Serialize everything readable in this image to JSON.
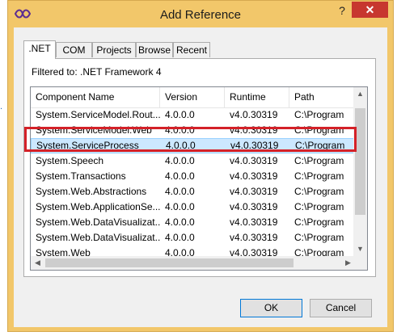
{
  "window": {
    "title": "Add Reference",
    "help_label": "?",
    "close_label": "✕"
  },
  "tabs": [
    {
      "label": ".NET",
      "active": true
    },
    {
      "label": "COM"
    },
    {
      "label": "Projects"
    },
    {
      "label": "Browse"
    },
    {
      "label": "Recent"
    }
  ],
  "filter_text": "Filtered to: .NET Framework 4",
  "columns": [
    "Component Name",
    "Version",
    "Runtime",
    "Path"
  ],
  "rows": [
    [
      "System.ServiceModel.Rout...",
      "4.0.0.0",
      "v4.0.30319",
      "C:\\Program"
    ],
    [
      "System.ServiceModel.Web",
      "4.0.0.0",
      "v4.0.30319",
      "C:\\Program"
    ],
    [
      "System.ServiceProcess",
      "4.0.0.0",
      "v4.0.30319",
      "C:\\Program"
    ],
    [
      "System.Speech",
      "4.0.0.0",
      "v4.0.30319",
      "C:\\Program"
    ],
    [
      "System.Transactions",
      "4.0.0.0",
      "v4.0.30319",
      "C:\\Program"
    ],
    [
      "System.Web.Abstractions",
      "4.0.0.0",
      "v4.0.30319",
      "C:\\Program"
    ],
    [
      "System.Web.ApplicationSe...",
      "4.0.0.0",
      "v4.0.30319",
      "C:\\Program"
    ],
    [
      "System.Web.DataVisualizat...",
      "4.0.0.0",
      "v4.0.30319",
      "C:\\Program"
    ],
    [
      "System.Web.DataVisualizat...",
      "4.0.0.0",
      "v4.0.30319",
      "C:\\Program"
    ],
    [
      "System.Web",
      "4.0.0.0",
      "v4.0.30319",
      "C:\\Program"
    ]
  ],
  "selected_row": 2,
  "buttons": {
    "ok": "OK",
    "cancel": "Cancel"
  },
  "colors": {
    "highlight_border": "#d42128",
    "selection": "#cce8ff",
    "title_bar": "#f2c76a"
  }
}
